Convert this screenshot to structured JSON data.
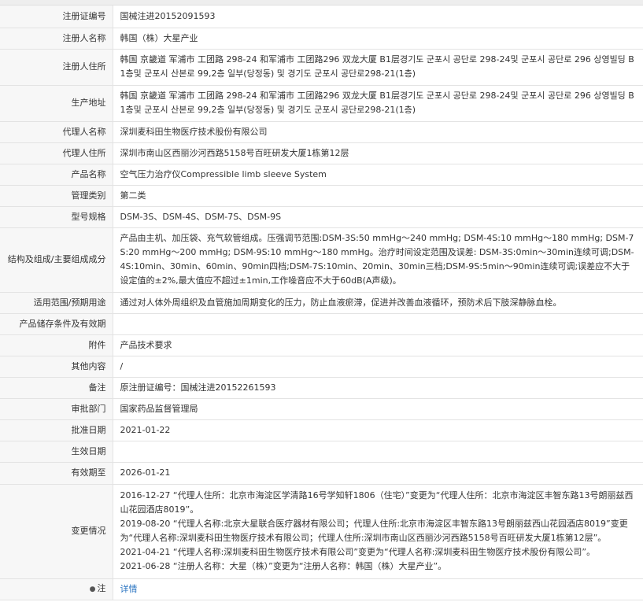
{
  "rows": [
    {
      "label": "注册证编号",
      "value": "国械注进20152091593",
      "h": 28
    },
    {
      "label": "注册人名称",
      "value": "韩国（株）大星产业",
      "h": 27
    },
    {
      "label": "注册人住所",
      "value": "韩国 京畿道 军浦市 工团路 298-24 和军浦市 工团路296 双龙大厦 B1层경기도 군포시 공단로 298-24및 군포시 공단로 296 상영빌딩 B1층및 군포시 산본로 99,2층 일부(당정동) 및 경기도 군포시 공단로298-21(1층)",
      "h": 46
    },
    {
      "label": "生产地址",
      "value": "韩国 京畿道 军浦市 工团路 298-24 和军浦市 工团路296 双龙大厦 B1层경기도 군포시 공단로 298-24및 군포시 공단로 296 상영빌딩 B1층및 군포시 산본로 99,2층 일부(당정동) 및 경기도 군포시 공단로298-21(1층)",
      "h": 46
    },
    {
      "label": "代理人名称",
      "value": "深圳麦科田生物医疗技术股份有限公司",
      "h": 27
    },
    {
      "label": "代理人住所",
      "value": "深圳市南山区西丽沙河西路5158号百旺研发大厦1栋第12层",
      "h": 27
    },
    {
      "label": "产品名称",
      "value": "空气压力治疗仪Compressible limb sleeve System",
      "h": 27
    },
    {
      "label": "管理类别",
      "value": "第二类",
      "h": 27
    },
    {
      "label": "型号规格",
      "value": "DSM-3S、DSM-4S、DSM-7S、DSM-9S",
      "h": 27
    },
    {
      "label": "结构及组成/主要组成成分",
      "value": "产品由主机、加压袋、充气软管组成。压强调节范围:DSM-3S:50 mmHg～240 mmHg; DSM-4S:10 mmHg～180 mmHg; DSM-7S:20 mmHg～200 mmHg; DSM-9S:10 mmHg～180 mmHg。治疗时间设定范围及误差: DSM-3S:0min～30min连续可调;DSM-4S:10min、30min、60min、90min四档;DSM-7S:10min、20min、30min三档;DSM-9S:5min～90min连续可调;误差应不大于设定值的±2%,最大值应不超过±1min,工作噪音应不大于60dB(A声级)。",
      "h": 82
    },
    {
      "label": "适用范围/预期用途",
      "value": "通过对人体外周组织及血管施加周期变化的压力，防止血液瘀滞，促进并改善血液循环，预防术后下肢深静脉血栓。",
      "h": 27
    },
    {
      "label": "产品储存条件及有效期",
      "value": "",
      "h": 27
    },
    {
      "label": "附件",
      "value": "产品技术要求",
      "h": 27
    },
    {
      "label": "其他内容",
      "value": "/",
      "h": 27
    },
    {
      "label": "备注",
      "value": "原注册证编号：国械注进20152261593",
      "h": 27
    },
    {
      "label": "审批部门",
      "value": "国家药品监督管理局",
      "h": 27
    },
    {
      "label": "批准日期",
      "value": "2021-01-22",
      "h": 27
    },
    {
      "label": "生效日期",
      "value": "",
      "h": 27
    },
    {
      "label": "有效期至",
      "value": "2026-01-21",
      "h": 28
    }
  ],
  "history": {
    "label": "变更情况",
    "h": 120,
    "lines": [
      "2016-12-27 “代理人住所：北京市海淀区学清路16号学知轩1806（住宅）”变更为“代理人住所：北京市海淀区丰智东路13号朗丽兹西山花园酒店8019”。",
      "2019-08-20 “代理人名称:北京大星联合医疗器材有限公司；代理人住所:北京市海淀区丰智东路13号朗丽兹西山花园酒店8019”变更为“代理人名称:深圳麦科田生物医疗技术有限公司；代理人住所:深圳市南山区西丽沙河西路5158号百旺研发大厦1栋第12层”。",
      "2021-04-21 “代理人名称:深圳麦科田生物医疗技术有限公司”变更为“代理人名称:深圳麦科田生物医疗技术股份有限公司”。",
      "2021-06-28 “注册人名称：大星（株）”变更为“注册人名称：韩国（株）大星产业”。"
    ]
  },
  "note": {
    "label": "注",
    "link_text": "详情"
  }
}
